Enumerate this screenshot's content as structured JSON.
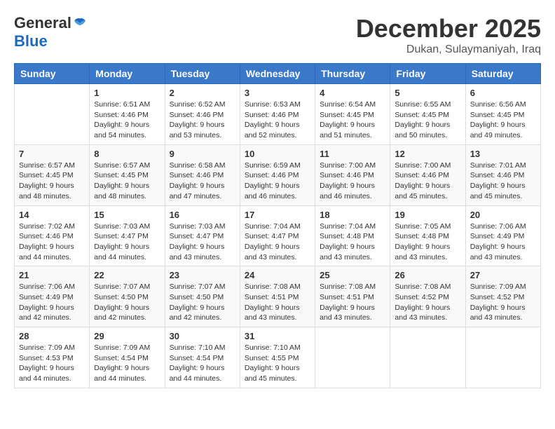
{
  "header": {
    "logo_general": "General",
    "logo_blue": "Blue",
    "month_title": "December 2025",
    "location": "Dukan, Sulaymaniyah, Iraq"
  },
  "weekdays": [
    "Sunday",
    "Monday",
    "Tuesday",
    "Wednesday",
    "Thursday",
    "Friday",
    "Saturday"
  ],
  "weeks": [
    [
      {
        "day": "",
        "info": ""
      },
      {
        "day": "1",
        "info": "Sunrise: 6:51 AM\nSunset: 4:46 PM\nDaylight: 9 hours\nand 54 minutes."
      },
      {
        "day": "2",
        "info": "Sunrise: 6:52 AM\nSunset: 4:46 PM\nDaylight: 9 hours\nand 53 minutes."
      },
      {
        "day": "3",
        "info": "Sunrise: 6:53 AM\nSunset: 4:46 PM\nDaylight: 9 hours\nand 52 minutes."
      },
      {
        "day": "4",
        "info": "Sunrise: 6:54 AM\nSunset: 4:45 PM\nDaylight: 9 hours\nand 51 minutes."
      },
      {
        "day": "5",
        "info": "Sunrise: 6:55 AM\nSunset: 4:45 PM\nDaylight: 9 hours\nand 50 minutes."
      },
      {
        "day": "6",
        "info": "Sunrise: 6:56 AM\nSunset: 4:45 PM\nDaylight: 9 hours\nand 49 minutes."
      }
    ],
    [
      {
        "day": "7",
        "info": "Sunrise: 6:57 AM\nSunset: 4:45 PM\nDaylight: 9 hours\nand 48 minutes."
      },
      {
        "day": "8",
        "info": "Sunrise: 6:57 AM\nSunset: 4:45 PM\nDaylight: 9 hours\nand 48 minutes."
      },
      {
        "day": "9",
        "info": "Sunrise: 6:58 AM\nSunset: 4:46 PM\nDaylight: 9 hours\nand 47 minutes."
      },
      {
        "day": "10",
        "info": "Sunrise: 6:59 AM\nSunset: 4:46 PM\nDaylight: 9 hours\nand 46 minutes."
      },
      {
        "day": "11",
        "info": "Sunrise: 7:00 AM\nSunset: 4:46 PM\nDaylight: 9 hours\nand 46 minutes."
      },
      {
        "day": "12",
        "info": "Sunrise: 7:00 AM\nSunset: 4:46 PM\nDaylight: 9 hours\nand 45 minutes."
      },
      {
        "day": "13",
        "info": "Sunrise: 7:01 AM\nSunset: 4:46 PM\nDaylight: 9 hours\nand 45 minutes."
      }
    ],
    [
      {
        "day": "14",
        "info": "Sunrise: 7:02 AM\nSunset: 4:46 PM\nDaylight: 9 hours\nand 44 minutes."
      },
      {
        "day": "15",
        "info": "Sunrise: 7:03 AM\nSunset: 4:47 PM\nDaylight: 9 hours\nand 44 minutes."
      },
      {
        "day": "16",
        "info": "Sunrise: 7:03 AM\nSunset: 4:47 PM\nDaylight: 9 hours\nand 43 minutes."
      },
      {
        "day": "17",
        "info": "Sunrise: 7:04 AM\nSunset: 4:47 PM\nDaylight: 9 hours\nand 43 minutes."
      },
      {
        "day": "18",
        "info": "Sunrise: 7:04 AM\nSunset: 4:48 PM\nDaylight: 9 hours\nand 43 minutes."
      },
      {
        "day": "19",
        "info": "Sunrise: 7:05 AM\nSunset: 4:48 PM\nDaylight: 9 hours\nand 43 minutes."
      },
      {
        "day": "20",
        "info": "Sunrise: 7:06 AM\nSunset: 4:49 PM\nDaylight: 9 hours\nand 43 minutes."
      }
    ],
    [
      {
        "day": "21",
        "info": "Sunrise: 7:06 AM\nSunset: 4:49 PM\nDaylight: 9 hours\nand 42 minutes."
      },
      {
        "day": "22",
        "info": "Sunrise: 7:07 AM\nSunset: 4:50 PM\nDaylight: 9 hours\nand 42 minutes."
      },
      {
        "day": "23",
        "info": "Sunrise: 7:07 AM\nSunset: 4:50 PM\nDaylight: 9 hours\nand 42 minutes."
      },
      {
        "day": "24",
        "info": "Sunrise: 7:08 AM\nSunset: 4:51 PM\nDaylight: 9 hours\nand 43 minutes."
      },
      {
        "day": "25",
        "info": "Sunrise: 7:08 AM\nSunset: 4:51 PM\nDaylight: 9 hours\nand 43 minutes."
      },
      {
        "day": "26",
        "info": "Sunrise: 7:08 AM\nSunset: 4:52 PM\nDaylight: 9 hours\nand 43 minutes."
      },
      {
        "day": "27",
        "info": "Sunrise: 7:09 AM\nSunset: 4:52 PM\nDaylight: 9 hours\nand 43 minutes."
      }
    ],
    [
      {
        "day": "28",
        "info": "Sunrise: 7:09 AM\nSunset: 4:53 PM\nDaylight: 9 hours\nand 44 minutes."
      },
      {
        "day": "29",
        "info": "Sunrise: 7:09 AM\nSunset: 4:54 PM\nDaylight: 9 hours\nand 44 minutes."
      },
      {
        "day": "30",
        "info": "Sunrise: 7:10 AM\nSunset: 4:54 PM\nDaylight: 9 hours\nand 44 minutes."
      },
      {
        "day": "31",
        "info": "Sunrise: 7:10 AM\nSunset: 4:55 PM\nDaylight: 9 hours\nand 45 minutes."
      },
      {
        "day": "",
        "info": ""
      },
      {
        "day": "",
        "info": ""
      },
      {
        "day": "",
        "info": ""
      }
    ]
  ]
}
